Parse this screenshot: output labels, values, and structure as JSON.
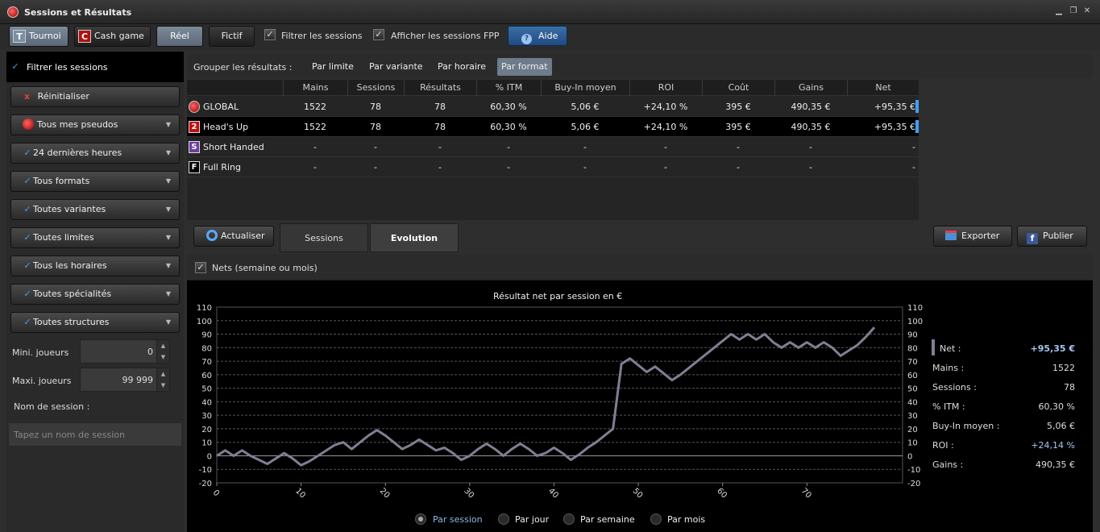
{
  "window": {
    "title": "Sessions et Résultats"
  },
  "toolbar": {
    "tournoi": "Tournoi",
    "tournoi_badge": "T",
    "cash": "Cash game",
    "cash_badge": "C",
    "reel": "Réel",
    "fictif": "Fictif",
    "filtrer": "Filtrer les sessions",
    "fpp": "Afficher les sessions FPP",
    "aide": "Aide"
  },
  "sidebar": {
    "header": "Filtrer les sessions",
    "reset": "Réinitialiser",
    "filters": [
      "Tous mes pseudos",
      "24 dernières heures",
      "Tous formats",
      "Toutes variantes",
      "Toutes limites",
      "Tous les horaires",
      "Toutes spécialités",
      "Toutes structures"
    ],
    "mini_label": "Mini. joueurs",
    "mini_value": "0",
    "maxi_label": "Maxi. joueurs",
    "maxi_value": "99 999",
    "name_label": "Nom de session :",
    "name_placeholder": "Tapez un nom de session"
  },
  "group": {
    "label": "Grouper les résultats :",
    "options": [
      "Par limite",
      "Par variante",
      "Par horaire",
      "Par format"
    ],
    "selected": "Par format"
  },
  "table": {
    "columns": [
      "Mains",
      "Sessions",
      "Résultats",
      "% ITM",
      "Buy-In moyen",
      "ROI",
      "Coût",
      "Gains",
      "Net"
    ],
    "rows": [
      {
        "name": "GLOBAL",
        "icon": "",
        "cells": [
          "1522",
          "78",
          "78",
          "60,30 %",
          "5,06 €",
          "+24,10 %",
          "395 €",
          "490,35 €",
          "+95,35 €"
        ]
      },
      {
        "name": "Head's Up",
        "icon": "2",
        "cells": [
          "1522",
          "78",
          "78",
          "60,30 %",
          "5,06 €",
          "+24,10 %",
          "395 €",
          "490,35 €",
          "+95,35 €"
        ]
      },
      {
        "name": "Short Handed",
        "icon": "S",
        "cells": [
          "-",
          "-",
          "-",
          "-",
          "-",
          "-",
          "-",
          "-",
          "-"
        ]
      },
      {
        "name": "Full Ring",
        "icon": "F",
        "cells": [
          "-",
          "-",
          "-",
          "-",
          "-",
          "-",
          "-",
          "-",
          "-"
        ]
      }
    ]
  },
  "actions": {
    "actualiser": "Actualiser",
    "exporter": "Exporter",
    "publier": "Publier"
  },
  "tabs": [
    "Sessions",
    "Evolution"
  ],
  "active_tab": "Evolution",
  "panel": {
    "nets_label": "Nets (semaine ou mois)"
  },
  "chart_data": {
    "type": "line",
    "title": "Résultat net par session en €",
    "xlabel": "",
    "ylabel": "",
    "ylim": [
      -20,
      110
    ],
    "xlim": [
      0,
      78
    ],
    "yticks": [
      110,
      100,
      90,
      80,
      70,
      60,
      50,
      40,
      30,
      20,
      10,
      0,
      -10,
      -20
    ],
    "xticks": [
      0,
      10,
      20,
      30,
      40,
      50,
      60,
      70
    ],
    "grid": true,
    "series": [
      {
        "x": [
          0,
          1,
          2,
          3,
          4,
          5,
          6,
          7,
          8,
          9,
          10,
          11,
          12,
          13,
          14,
          15,
          16,
          17,
          18,
          19,
          20,
          21,
          22,
          23,
          24,
          25,
          26,
          27,
          28,
          29,
          30,
          31,
          32,
          33,
          34,
          35,
          36,
          37,
          38,
          39,
          40,
          41,
          42,
          43,
          44,
          45,
          46,
          47,
          48,
          49,
          50,
          51,
          52,
          53,
          54,
          55,
          56,
          57,
          58,
          59,
          60,
          61,
          62,
          63,
          64,
          65,
          66,
          67,
          68,
          69,
          70,
          71,
          72,
          73,
          74,
          75,
          76,
          77,
          78
        ],
        "values": [
          0,
          4,
          0,
          4,
          0,
          -3,
          -6,
          -2,
          2,
          -2,
          -7,
          -4,
          0,
          4,
          8,
          10,
          5,
          10,
          15,
          19,
          15,
          10,
          5,
          8,
          12,
          8,
          4,
          6,
          2,
          -3,
          0,
          5,
          9,
          5,
          0,
          5,
          9,
          5,
          0,
          2,
          6,
          2,
          -3,
          1,
          6,
          10,
          15,
          20,
          68,
          72,
          67,
          62,
          66,
          61,
          56,
          60,
          65,
          70,
          75,
          80,
          85,
          90,
          86,
          90,
          86,
          90,
          84,
          80,
          84,
          80,
          84,
          80,
          84,
          80,
          74,
          78,
          82,
          88,
          95
        ]
      }
    ]
  },
  "stats": [
    {
      "label": "Net :",
      "value": "+95,35 €"
    },
    {
      "label": "Mains :",
      "value": "1522"
    },
    {
      "label": "Sessions :",
      "value": "78"
    },
    {
      "label": "% ITM :",
      "value": "60,30 %"
    },
    {
      "label": "Buy-In moyen :",
      "value": "5,06 €"
    },
    {
      "label": "ROI :",
      "value": "+24,14 %"
    },
    {
      "label": "Gains :",
      "value": "490,35 €"
    }
  ],
  "period": {
    "options": [
      "Par session",
      "Par jour",
      "Par semaine",
      "Par mois"
    ],
    "selected": "Par session"
  },
  "colors": {
    "accent": "#3da0ff",
    "line": "#7f7f93",
    "selected_bg": "#6e7b8a"
  }
}
